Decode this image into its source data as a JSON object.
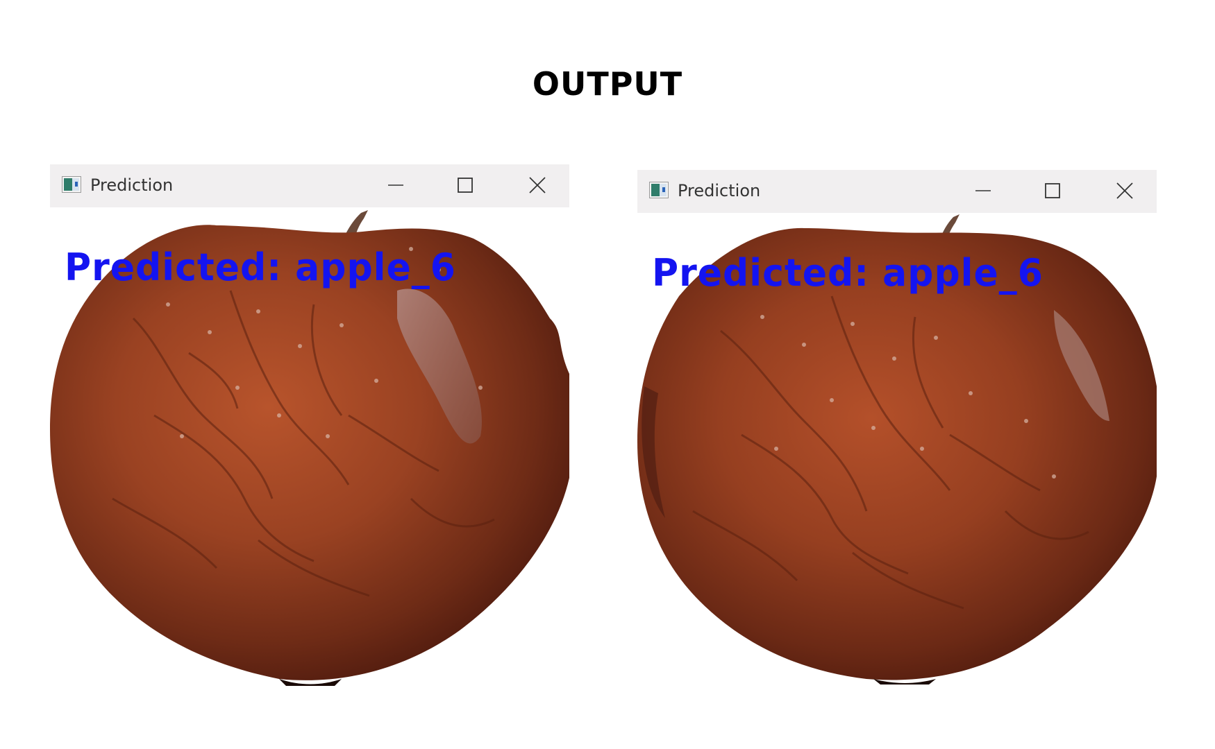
{
  "page": {
    "title": "OUTPUT"
  },
  "windows": [
    {
      "title": "Prediction",
      "prediction_text": "Predicted: apple_6",
      "controls": [
        "minimize-icon",
        "maximize-icon",
        "close-icon"
      ]
    },
    {
      "title": "Prediction",
      "prediction_text": "Predicted: apple_6",
      "controls": [
        "minimize-icon",
        "maximize-icon",
        "close-icon"
      ]
    }
  ],
  "colors": {
    "prediction_text": "#1414f0",
    "titlebar": "#f1eff0",
    "apple_main": "#8e3a1e",
    "apple_dark": "#4e1a0e",
    "apple_highlight": "#b8542c"
  }
}
